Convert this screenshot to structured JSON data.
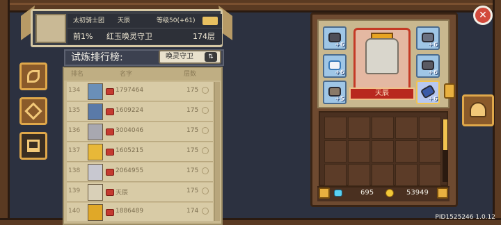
{
  "player": {
    "guild": "太初骑士团",
    "name": "天辰",
    "level": "等级50(+61)",
    "percentile": "前1%",
    "title": "红玉唤灵守卫",
    "floor": "174层"
  },
  "ranking": {
    "title": "试炼排行榜:",
    "selected": "唤灵守卫",
    "swap_icon": "swap-arrows-icon",
    "headers": {
      "rank": "排名",
      "name": "名字",
      "floor": "层数"
    },
    "rows": [
      {
        "rank": "134",
        "name": "1797464",
        "floor": "175",
        "face": "#6a8fb8"
      },
      {
        "rank": "135",
        "name": "1609224",
        "floor": "175",
        "face": "#5a7aa8"
      },
      {
        "rank": "136",
        "name": "3004046",
        "floor": "175",
        "face": "#a8a8b0"
      },
      {
        "rank": "137",
        "name": "1605215",
        "floor": "175",
        "face": "#e8b838"
      },
      {
        "rank": "138",
        "name": "2064955",
        "floor": "175",
        "face": "#c8c8d0"
      },
      {
        "rank": "139",
        "name": "天辰",
        "floor": "175",
        "face": "#d9d0b8"
      },
      {
        "rank": "140",
        "name": "1886489",
        "floor": "174",
        "face": "#e0a828"
      }
    ]
  },
  "side_tabs": [
    {
      "icon": "leaf-icon"
    },
    {
      "icon": "diamond-icon"
    },
    {
      "icon": "podium-icon"
    }
  ],
  "equipment": {
    "hero_name": "天辰",
    "slots": [
      {
        "plus": "+6"
      },
      {
        "plus": "+6"
      },
      {
        "plus": "+6"
      },
      {
        "plus": "+6"
      },
      {
        "plus": "+5"
      },
      {
        "plus": "+6"
      }
    ]
  },
  "currency": {
    "gems": "695",
    "coins": "53949"
  },
  "footer": {
    "pid": "PID1525246 1.0.12"
  }
}
